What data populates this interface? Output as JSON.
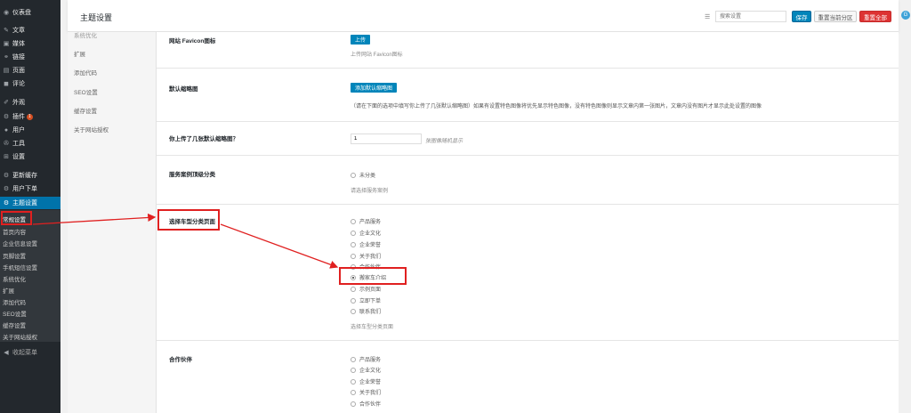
{
  "sidebar": {
    "menu": [
      {
        "icon": "dashboard-icon",
        "glyph": "◉",
        "label": "仪表盘"
      },
      {
        "icon": "pin-icon",
        "glyph": "✎",
        "label": "文章"
      },
      {
        "icon": "media-icon",
        "glyph": "▣",
        "label": "媒体"
      },
      {
        "icon": "link-icon",
        "glyph": "⚭",
        "label": "链接"
      },
      {
        "icon": "page-icon",
        "glyph": "▤",
        "label": "页面"
      },
      {
        "icon": "comment-icon",
        "glyph": "◼",
        "label": "评论"
      },
      {
        "icon": "appearance-icon",
        "glyph": "✐",
        "label": "外观"
      },
      {
        "icon": "plugin-icon",
        "glyph": "⚙",
        "label": "插件",
        "badge": "1"
      },
      {
        "icon": "user-icon",
        "glyph": "●",
        "label": "用户"
      },
      {
        "icon": "tool-icon",
        "glyph": "✇",
        "label": "工具"
      },
      {
        "icon": "settings-icon",
        "glyph": "⊞",
        "label": "设置"
      },
      {
        "icon": "update-cache-icon",
        "glyph": "⚙",
        "label": "更新缓存"
      },
      {
        "icon": "user-order-icon",
        "glyph": "⚙",
        "label": "用户下单"
      },
      {
        "icon": "theme-settings-icon",
        "glyph": "⚙",
        "label": "主题设置"
      }
    ],
    "submenu": [
      "常规设置",
      "首页内容",
      "企业信息设置",
      "页脚设置",
      "手机短信设置",
      "系统优化",
      "扩展",
      "添加代码",
      "SEO设置",
      "缓存设置",
      "关于网站授权"
    ],
    "collapse": {
      "icon": "collapse-icon",
      "glyph": "◀",
      "label": "收起菜单"
    }
  },
  "header": {
    "title": "主题设置",
    "search_placeholder": "搜索设置",
    "save": "保存",
    "reset_section": "重置当前分区",
    "reset_all": "重置全部"
  },
  "section_nav": [
    "系统优化",
    "扩展",
    "添加代码",
    "SEO设置",
    "缓存设置",
    "关于网站授权"
  ],
  "fields": {
    "favicon": {
      "label": "网站 Favicon图标",
      "button": "上传",
      "desc": "上传网站 Favicon图标"
    },
    "thumb": {
      "label": "默认缩略图",
      "button": "添加默认缩略图",
      "desc": "（请在下面的选项中填写你上传了几张默认缩略图）如果有设置特色图像将优先显示特色图像，没有特色图像则显示文章内第一张图片，文章内没有图片才显示此处设置的图像"
    },
    "thumb_count": {
      "label": "你上传了几张默认缩略图？",
      "value": "1",
      "note": "张图像随机显示"
    },
    "service_cat": {
      "label": "服务案例顶级分类",
      "options": [
        "未分类"
      ],
      "desc": "请选择服务案例"
    },
    "car_page": {
      "label": "选择车型分类页面",
      "options": [
        "产品服务",
        "企业文化",
        "企业荣誉",
        "关于我们",
        "合作伙伴",
        "搬家车介绍",
        "示例页面",
        "立即下单",
        "联系我们"
      ],
      "selected": "搬家车介绍",
      "desc": "选择车型分类页面"
    },
    "partner": {
      "label": "合作伙伴",
      "options": [
        "产品服务",
        "企业文化",
        "企业荣誉",
        "关于我们",
        "合作伙伴"
      ]
    }
  }
}
